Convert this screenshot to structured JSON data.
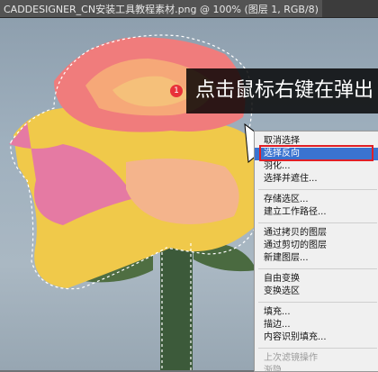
{
  "document_tab": {
    "title": "CADDESIGNER_CN安装工具教程素材.png @ 100% (图层 1, RGB/8)"
  },
  "callout": {
    "badge": "1",
    "text": "点击鼠标右键在弹出"
  },
  "context_menu": {
    "groups": [
      [
        {
          "label": "取消选择"
        },
        {
          "label": "选择反向",
          "state": "active"
        },
        {
          "label": "羽化..."
        },
        {
          "label": "选择并遮住..."
        }
      ],
      [
        {
          "label": "存储选区..."
        },
        {
          "label": "建立工作路径..."
        }
      ],
      [
        {
          "label": "通过拷贝的图层"
        },
        {
          "label": "通过剪切的图层"
        },
        {
          "label": "新建图层..."
        }
      ],
      [
        {
          "label": "自由变换"
        },
        {
          "label": "变换选区"
        }
      ],
      [
        {
          "label": "填充..."
        },
        {
          "label": "描边..."
        },
        {
          "label": "内容识别填充..."
        }
      ],
      [
        {
          "label": "上次滤镜操作",
          "state": "disabled"
        },
        {
          "label": "渐隐...",
          "state": "disabled"
        }
      ]
    ]
  },
  "colors": {
    "highlight": "#3a73d0",
    "annotation_red": "#e01f26"
  }
}
